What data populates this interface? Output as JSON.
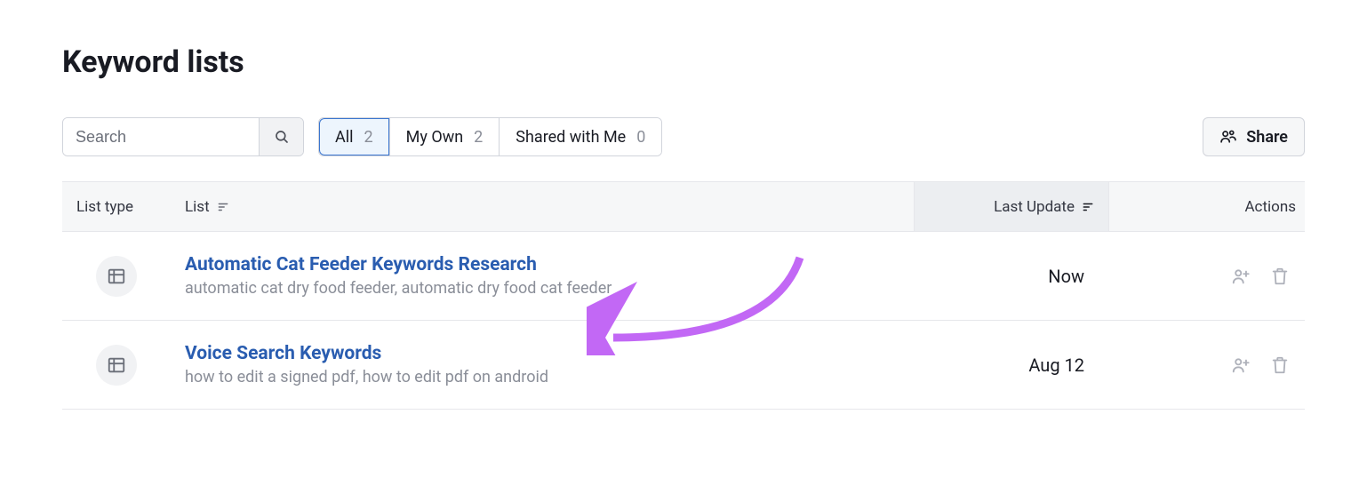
{
  "title": "Keyword lists",
  "search": {
    "placeholder": "Search"
  },
  "tabs": [
    {
      "label": "All",
      "count": "2",
      "active": true
    },
    {
      "label": "My Own",
      "count": "2",
      "active": false
    },
    {
      "label": "Shared with Me",
      "count": "0",
      "active": false
    }
  ],
  "share_label": "Share",
  "columns": {
    "type": "List type",
    "list": "List",
    "update": "Last Update",
    "actions": "Actions"
  },
  "rows": [
    {
      "title": "Automatic Cat Feeder Keywords Research",
      "subtitle": "automatic cat dry food feeder, automatic dry food cat feeder",
      "updated": "Now"
    },
    {
      "title": "Voice Search Keywords",
      "subtitle": "how to edit a signed pdf, how to edit pdf on android",
      "updated": "Aug 12"
    }
  ]
}
